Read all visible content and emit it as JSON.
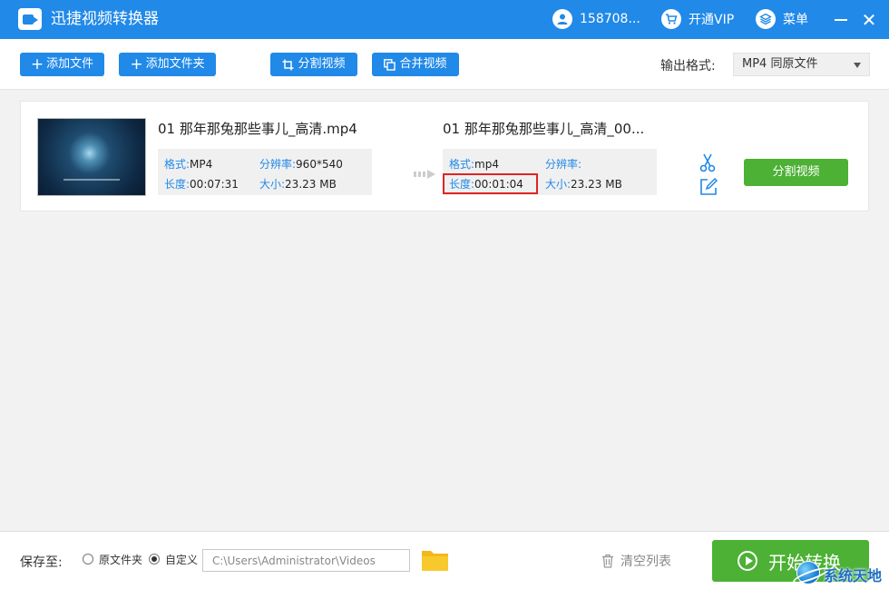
{
  "titlebar": {
    "app_title": "迅捷视频转换器",
    "user_phone": "158708...",
    "vip_label": "开通VIP",
    "menu_label": "菜单",
    "close_glyph": "✕"
  },
  "toolbar": {
    "add_file": "添加文件",
    "add_folder": "添加文件夹",
    "split_video": "分割视频",
    "merge_video": "合并视频",
    "output_format_label": "输出格式:",
    "output_format_value": "MP4  同原文件"
  },
  "file_item": {
    "source": {
      "name": "01 那年那兔那些事儿_高清.mp4",
      "format_label": "格式:",
      "format_value": "MP4",
      "resolution_label": "分辨率:",
      "resolution_value": "960*540",
      "duration_label": "长度:",
      "duration_value": "00:07:31",
      "size_label": "大小:",
      "size_value": "23.23 MB"
    },
    "output": {
      "name": "01 那年那兔那些事儿_高清_00...",
      "format_label": "格式:",
      "format_value": "mp4",
      "resolution_label": "分辨率:",
      "resolution_value": "",
      "duration_label": "长度:",
      "duration_value": "00:01:04",
      "size_label": "大小:",
      "size_value": "23.23 MB"
    },
    "split_button": "分割视频"
  },
  "bottom": {
    "save_to_label": "保存至:",
    "option_original": "原文件夹",
    "option_custom": "自定义",
    "selected_option": "自定义",
    "path_value": "C:\\Users\\Administrator\\Videos",
    "clear_list": "清空列表",
    "start_convert": "开始转换"
  },
  "watermark": {
    "text": "系统天地"
  },
  "colors": {
    "primary_blue": "#2189e8",
    "action_green": "#4cb134",
    "highlight_red": "#e02424",
    "background": "#f2f2f2"
  }
}
